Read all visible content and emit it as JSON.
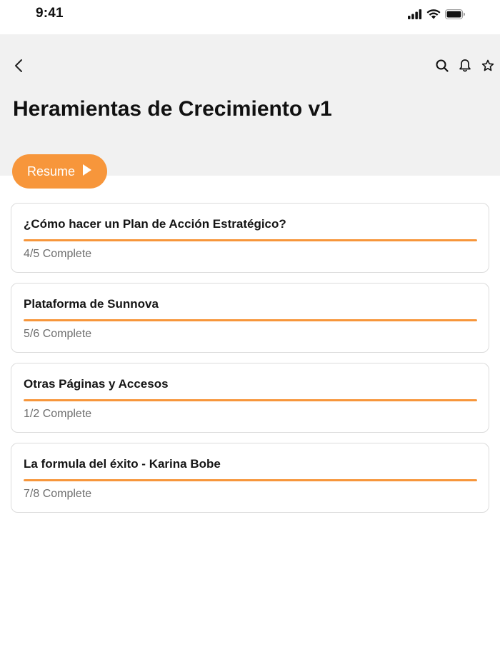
{
  "status_bar": {
    "time": "9:41",
    "icons": [
      "cellular-signal-icon",
      "wifi-icon",
      "battery-icon"
    ]
  },
  "header": {
    "title": "Heramientas de Crecimiento v1",
    "back_icon": "chevron-left-icon",
    "actions": [
      "search-icon",
      "bell-icon",
      "star-icon"
    ]
  },
  "resume_button": {
    "label": "Resume",
    "icon": "play-icon"
  },
  "colors": {
    "accent": "#f7963b",
    "header_background": "#f1f1f1",
    "progress_track": "#e6e6e6"
  },
  "modules": [
    {
      "title": "¿Cómo hacer un Plan de Acción Estratégico?",
      "status": "4/5 Complete",
      "progress": 1.0
    },
    {
      "title": "Plataforma de Sunnova",
      "status": "5/6 Complete",
      "progress": 1.0
    },
    {
      "title": "Otras Páginas y Accesos",
      "status": "1/2 Complete",
      "progress": 1.0
    },
    {
      "title": "La formula del éxito - Karina Bobe",
      "status": "7/8 Complete",
      "progress": 1.0
    }
  ]
}
